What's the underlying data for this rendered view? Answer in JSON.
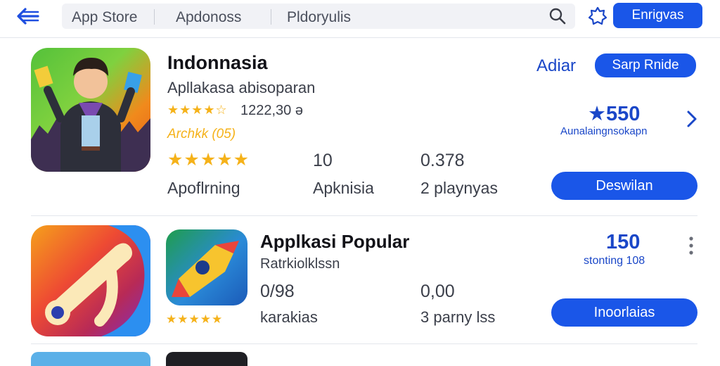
{
  "header": {
    "menu_icon": "back-arrow-icon",
    "search_segments": [
      "App Store",
      "Apdonoss",
      "Pldoryulis"
    ],
    "action_label": "Enrigvas"
  },
  "apps": [
    {
      "title": "Indonnasia",
      "subtitle": "Apllakasa abisoparan",
      "rating_line_1": "1222,30 ə",
      "rating_line_2": "Archkk (05)",
      "rating_line_2_count": "(05)",
      "stars": "★★★★★",
      "star_fill": 0.8,
      "stat_1_value": "10",
      "stat_2_value": "0.378",
      "stat_label_1": "Apoflrning",
      "stat_label_2": "Apknisia",
      "stat_label_3": "2 playnyas",
      "link_label": "Adiar",
      "pill_label": "Sarp Rnide",
      "score": "★550",
      "score_label": "Aunalaingnsokapn",
      "download_label": "Deswilan"
    },
    {
      "title": "Applkasi  Popular",
      "subtitle": "Ratrkiolklssn",
      "stars": "★★★★★",
      "stat_1_value": "0/98",
      "stat_2_value": "0,00",
      "stat_label_1": "karakias",
      "stat_label_2": "3 parny lss",
      "score": "150",
      "score_label": "stonting 108",
      "install_label": "Inoorlaias"
    }
  ],
  "colors": {
    "accent": "#1a56e8",
    "star": "#f5b21a",
    "link": "#1a47c8"
  }
}
